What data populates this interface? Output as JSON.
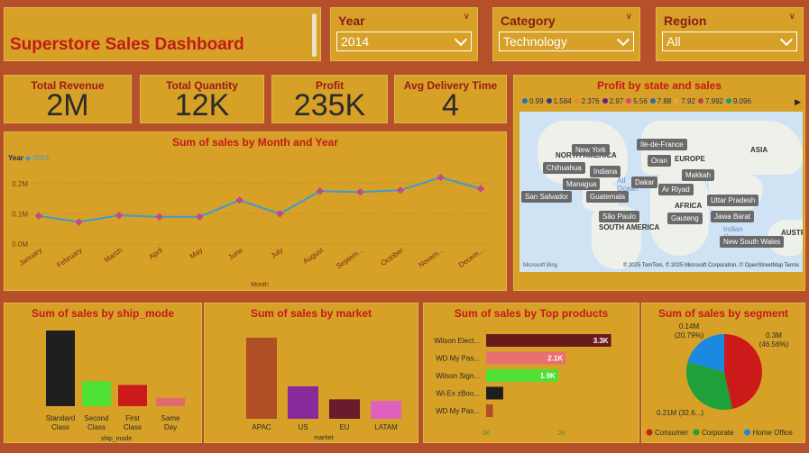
{
  "dashboard": {
    "title": "Superstore Sales Dashboard"
  },
  "slicers": [
    {
      "label": "Year",
      "value": "2014"
    },
    {
      "label": "Category",
      "value": "Technology"
    },
    {
      "label": "Region",
      "value": "All"
    }
  ],
  "kpis": [
    {
      "label": "Total Revenue",
      "value": "2M"
    },
    {
      "label": "Total Quantity",
      "value": "12K"
    },
    {
      "label": "Profit",
      "value": "235K"
    },
    {
      "label": "Avg Delivery Time",
      "value": "4"
    }
  ],
  "map": {
    "title": "Profit by state and sales",
    "legend": [
      {
        "label": "0.99",
        "color": "#1f77b4"
      },
      {
        "label": "1.584",
        "color": "#2a3a8a"
      },
      {
        "label": "2.376",
        "color": "#e8892a"
      },
      {
        "label": "2.97",
        "color": "#6a1a8a"
      },
      {
        "label": "5.56",
        "color": "#e0407a"
      },
      {
        "label": "7.88",
        "color": "#2a6aaa"
      },
      {
        "label": "7.92",
        "color": "#e6a832"
      },
      {
        "label": "7.992",
        "color": "#c04040"
      },
      {
        "label": "9.096",
        "color": "#1a9a7a"
      }
    ],
    "places": [
      "New York",
      "Ile-de-France",
      "Oran",
      "Chihuahua",
      "Indiana",
      "Makkah",
      "Dakar",
      "Managua",
      "Ar Riyad",
      "San Salvador",
      "Guatemala",
      "Uttar Pradesh",
      "São Paulo",
      "Jawa Barat",
      "Gauteng",
      "New South Wales"
    ],
    "regions": [
      "NORTH AMERICA",
      "EUROPE",
      "ASIA",
      "AFRICA",
      "SOUTH AMERICA",
      "AUSTR",
      "Atl",
      "Ocean",
      "Indian",
      "Ocean"
    ],
    "attribution": "Microsoft Bing",
    "copyright": "© 2025 TomTom, © 2025 Microsoft Corporation, © OpenStreetMap  Terms"
  },
  "line_chart": {
    "title": "Sum of sales by Month and Year",
    "legend_title": "Year",
    "legend_item": "2014",
    "xlabel": "Month",
    "yticks": [
      "0.0M",
      "0.1M",
      "0.2M"
    ],
    "color": "#3a9ad9"
  },
  "ship_chart": {
    "title": "Sum of sales by ship_mode",
    "xlabel": "ship_mode"
  },
  "market_chart": {
    "title": "Sum of sales by market",
    "xlabel": "market"
  },
  "products_chart": {
    "title": "Sum of sales by Top products",
    "xticks": [
      "0K",
      "2K"
    ]
  },
  "segment_chart": {
    "title": "Sum of sales by segment",
    "labels": [
      "0.14M\n(20.79%)",
      "0.3M\n(46.56%)",
      "0.21M (32.6...)"
    ],
    "label_lines": [
      [
        "0.14M",
        "(20.79%)"
      ],
      [
        "0.3M",
        "(46.56%)"
      ],
      [
        "0.21M (32.6...)"
      ]
    ]
  },
  "chart_data": [
    {
      "type": "line",
      "title": "Sum of sales by Month and Year",
      "xlabel": "Month",
      "ylabel": "",
      "categories": [
        "January",
        "February",
        "March",
        "April",
        "May",
        "June",
        "July",
        "August",
        "Septem...",
        "October",
        "Novem...",
        "Decem..."
      ],
      "series": [
        {
          "name": "2014",
          "values": [
            0.093,
            0.073,
            0.095,
            0.09,
            0.09,
            0.145,
            0.1,
            0.175,
            0.172,
            0.178,
            0.22,
            0.183
          ]
        }
      ],
      "ylim": [
        0,
        0.25
      ],
      "grid": true,
      "legend": "top-left"
    },
    {
      "type": "bar",
      "title": "Sum of sales by ship_mode",
      "xlabel": "ship_mode",
      "categories": [
        "Standard Class",
        "Second Class",
        "First Class",
        "Same Day"
      ],
      "values": [
        1.0,
        0.33,
        0.28,
        0.11
      ],
      "colors": [
        "#1e1e1e",
        "#4ee034",
        "#cc1a1a",
        "#e06a6a"
      ]
    },
    {
      "type": "bar",
      "title": "Sum of sales by market",
      "xlabel": "market",
      "categories": [
        "APAC",
        "US",
        "EU",
        "LATAM"
      ],
      "values": [
        1.0,
        0.4,
        0.24,
        0.22
      ],
      "colors": [
        "#b04e24",
        "#8a2a9a",
        "#6a1a2a",
        "#e060c0"
      ]
    },
    {
      "type": "bar",
      "orientation": "horizontal",
      "title": "Sum of sales by Top products",
      "categories": [
        "Wilson Elect...",
        "WD My Pas...",
        "Wilson Sign...",
        "Wi-Ex zBoo...",
        "WD My Pas..."
      ],
      "values": [
        3.3,
        2.1,
        1.9,
        0.45,
        0.18
      ],
      "data_labels": [
        "3.3K",
        "2.1K",
        "1.9K",
        "",
        ""
      ],
      "unit": "K",
      "xlim": [
        0,
        4
      ],
      "colors": [
        "#6a1a1a",
        "#e87070",
        "#4ee034",
        "#1e1e1e",
        "#b04e24"
      ]
    },
    {
      "type": "pie",
      "title": "Sum of sales by segment",
      "categories": [
        "Consumer",
        "Corporate",
        "Home Office"
      ],
      "values": [
        46.56,
        32.65,
        20.79
      ],
      "colors": [
        "#cc1a1a",
        "#1ea03a",
        "#1a8ae0"
      ],
      "legend": "bottom"
    }
  ]
}
